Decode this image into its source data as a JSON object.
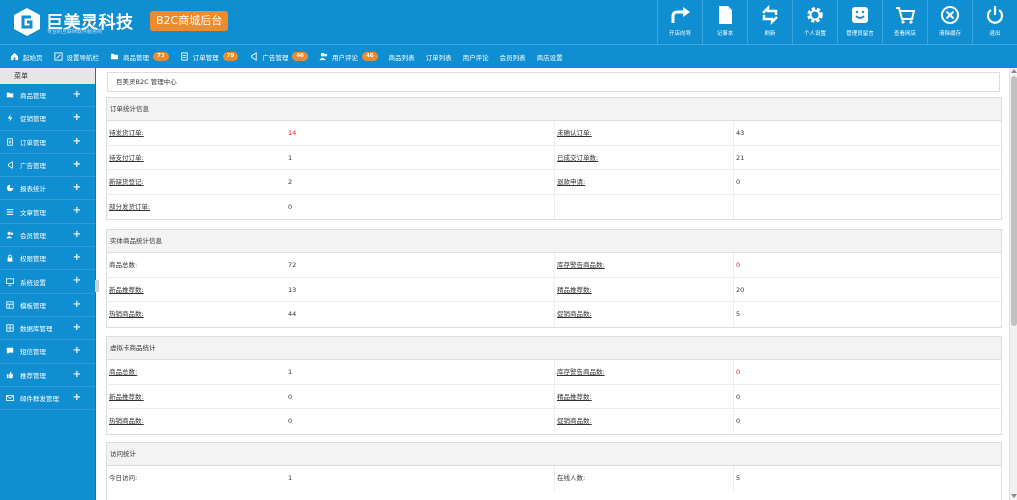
{
  "brand": {
    "name": "巨美灵科技",
    "slogan": "专业的互联网软件服务商",
    "badge": "B2C商城后台"
  },
  "toolbar": [
    {
      "label": "开店向导",
      "icon": "share-arrow-icon"
    },
    {
      "label": "记事本",
      "icon": "notepad-icon"
    },
    {
      "label": "刷新",
      "icon": "refresh-icon"
    },
    {
      "label": "个人设置",
      "icon": "gear-icon"
    },
    {
      "label": "管理员留言",
      "icon": "message-icon"
    },
    {
      "label": "查看网店",
      "icon": "cart-icon"
    },
    {
      "label": "清除缓存",
      "icon": "clear-cache-icon"
    },
    {
      "label": "退出",
      "icon": "power-icon"
    }
  ],
  "subnav": {
    "home": "起始页",
    "setup": "设置导航栏",
    "items": [
      {
        "label": "商品管理",
        "count": "73",
        "icon": "folder-icon"
      },
      {
        "label": "订单管理",
        "count": "79",
        "icon": "order-icon"
      },
      {
        "label": "广告管理",
        "count": "46",
        "icon": "megaphone-icon"
      },
      {
        "label": "用户评论",
        "count": "46",
        "icon": "users-icon"
      }
    ],
    "links": [
      "商品列表",
      "订单列表",
      "用户评论",
      "会员列表",
      "商店设置"
    ]
  },
  "sidebar": {
    "title": "菜单",
    "items": [
      {
        "label": "商品管理",
        "icon": "folder-icon"
      },
      {
        "label": "促销管理",
        "icon": "bolt-icon"
      },
      {
        "label": "订单管理",
        "icon": "order-icon"
      },
      {
        "label": "广告管理",
        "icon": "megaphone-icon"
      },
      {
        "label": "报表统计",
        "icon": "pie-chart-icon"
      },
      {
        "label": "文章管理",
        "icon": "list-icon"
      },
      {
        "label": "会员管理",
        "icon": "users-icon"
      },
      {
        "label": "权限管理",
        "icon": "lock-icon"
      },
      {
        "label": "系统设置",
        "icon": "monitor-icon"
      },
      {
        "label": "模板管理",
        "icon": "template-icon"
      },
      {
        "label": "数据库管理",
        "icon": "database-icon"
      },
      {
        "label": "短信管理",
        "icon": "chat-icon"
      },
      {
        "label": "推荐管理",
        "icon": "thumbs-up-icon"
      },
      {
        "label": "邮件群发管理",
        "icon": "mail-icon"
      }
    ]
  },
  "breadcrumb": "巨美灵B2C 管理中心",
  "sections": [
    {
      "title": "订单统计信息",
      "rows": [
        [
          {
            "label": "待发货订单:",
            "value": "14",
            "red": true,
            "link": true
          },
          {
            "label": "未确认订单:",
            "value": "43",
            "link": true
          }
        ],
        [
          {
            "label": "待支付订单:",
            "value": "1",
            "link": true
          },
          {
            "label": "已成交订单数:",
            "value": "21",
            "link": true
          }
        ],
        [
          {
            "label": "新缺货登记:",
            "value": "2",
            "link": true
          },
          {
            "label": "退款申请:",
            "value": "0",
            "link": true
          }
        ],
        [
          {
            "label": "部分发货订单:",
            "value": "0",
            "link": true
          },
          {
            "label": "",
            "value": ""
          }
        ]
      ]
    },
    {
      "title": "实体商品统计信息",
      "rows": [
        [
          {
            "label": "商品总数:",
            "value": "72"
          },
          {
            "label": "库存警告商品数:",
            "value": "0",
            "red": true,
            "link": true
          }
        ],
        [
          {
            "label": "新品推荐数:",
            "value": "13",
            "link": true
          },
          {
            "label": "精品推荐数:",
            "value": "20",
            "link": true
          }
        ],
        [
          {
            "label": "热销商品数:",
            "value": "44",
            "link": true
          },
          {
            "label": "促销商品数:",
            "value": "5",
            "link": true
          }
        ]
      ]
    },
    {
      "title": "虚拟卡商品统计",
      "rows": [
        [
          {
            "label": "商品总数:",
            "value": "1",
            "link": true
          },
          {
            "label": "库存警告商品数:",
            "value": "0",
            "red": true,
            "link": true
          }
        ],
        [
          {
            "label": "新品推荐数:",
            "value": "0",
            "link": true
          },
          {
            "label": "精品推荐数:",
            "value": "0",
            "link": true
          }
        ],
        [
          {
            "label": "热销商品数:",
            "value": "0",
            "link": true
          },
          {
            "label": "促销商品数:",
            "value": "0",
            "link": true
          }
        ]
      ]
    },
    {
      "title": "访问统计",
      "rows": [
        [
          {
            "label": "今日访问:",
            "value": "1"
          },
          {
            "label": "在线人数:",
            "value": "5"
          }
        ]
      ]
    }
  ]
}
